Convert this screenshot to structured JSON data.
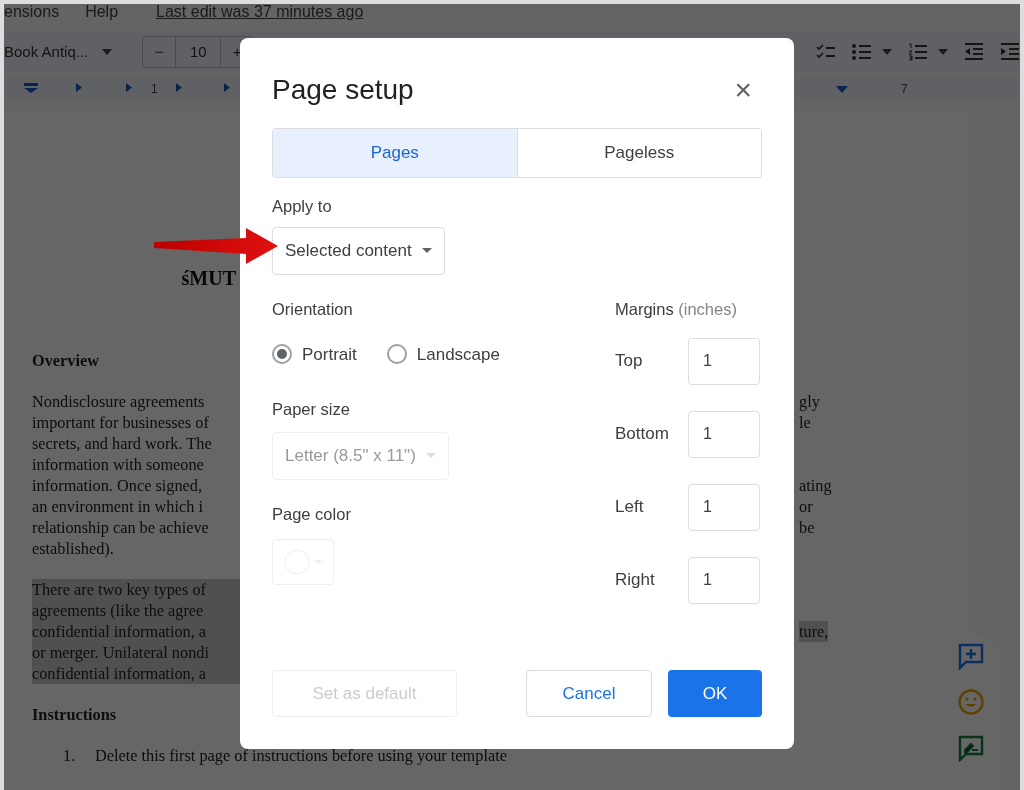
{
  "menu_bar": {
    "items": [
      "ensions",
      "Help"
    ],
    "last_edit": "Last edit was 37 minutes ago"
  },
  "toolbar": {
    "font": "Book Antiq...",
    "font_size": "10",
    "decrease": "−",
    "increase": "+"
  },
  "ruler": {
    "labels": [
      "1",
      "7"
    ]
  },
  "document": {
    "title": "śMUT",
    "blocks": [
      {
        "kind": "heading",
        "text": "Overview"
      },
      {
        "kind": "paragraph",
        "highlighted": false,
        "lines": [
          {
            "left": "Nondisclosure agreements",
            "right": "gly"
          },
          {
            "left": "important for businesses of",
            "right": "le"
          },
          {
            "left": "secrets, and hard work. The"
          },
          {
            "left": "information with someone"
          },
          {
            "left": "information. Once signed,",
            "right": "ating"
          },
          {
            "left": "an environment in which i",
            "right": "or"
          },
          {
            "left": "relationship can be achieve",
            "right": "be"
          },
          {
            "left": "established)."
          }
        ]
      },
      {
        "kind": "paragraph",
        "highlighted": true,
        "lines": [
          {
            "left": "There are two key types of"
          },
          {
            "left": "agreements (like the agree"
          },
          {
            "left": "confidential information, a",
            "right": "ture,"
          },
          {
            "left": "or merger. Unilateral nondi"
          },
          {
            "left": "confidential information, a"
          }
        ]
      },
      {
        "kind": "heading",
        "text": "Instructions"
      },
      {
        "kind": "list_item",
        "number": "1.",
        "text": "Delete this first page of instructions before using your template"
      }
    ]
  },
  "dialog": {
    "title": "Page setup",
    "close": "×",
    "tabs": [
      {
        "label": "Pages",
        "selected": true
      },
      {
        "label": "Pageless",
        "selected": false
      }
    ],
    "apply_to": {
      "label": "Apply to",
      "value": "Selected content"
    },
    "orientation": {
      "label": "Orientation",
      "options": [
        {
          "label": "Portrait",
          "selected": true
        },
        {
          "label": "Landscape",
          "selected": false
        }
      ]
    },
    "paper_size": {
      "label": "Paper size",
      "value": "Letter (8.5\" x 11\")",
      "disabled": true
    },
    "page_color": {
      "label": "Page color",
      "disabled": true
    },
    "margins": {
      "label": "Margins",
      "unit": "(inches)",
      "fields": [
        {
          "label": "Top",
          "value": "1"
        },
        {
          "label": "Bottom",
          "value": "1"
        },
        {
          "label": "Left",
          "value": "1"
        },
        {
          "label": "Right",
          "value": "1"
        }
      ]
    },
    "buttons": [
      {
        "label": "Set as default",
        "kind": "text",
        "disabled": true
      },
      {
        "label": "Cancel",
        "kind": "outline",
        "disabled": false
      },
      {
        "label": "OK",
        "kind": "primary",
        "disabled": false
      }
    ]
  }
}
